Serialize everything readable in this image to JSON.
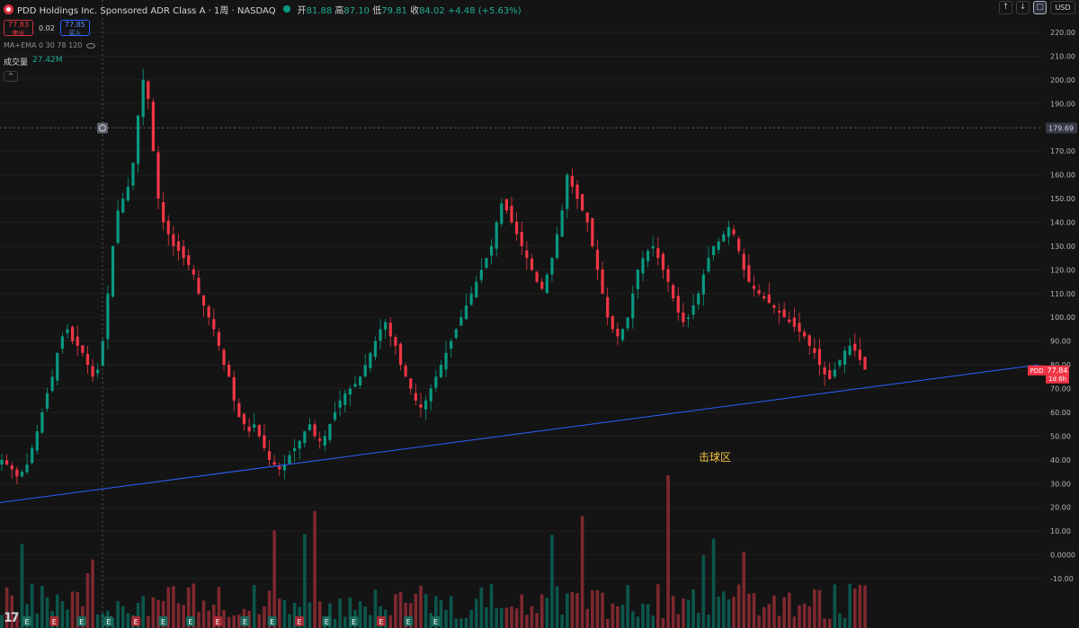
{
  "header": {
    "symbol_title": "PDD Holdings Inc. Sponsored ADR Class A · 1周 · NASDAQ",
    "open_label": "开",
    "open_value": "81.88",
    "high_label": "高",
    "high_value": "87.10",
    "low_label": "低",
    "low_value": "79.81",
    "close_label": "收",
    "close_value": "84.02",
    "change": "+4.48 (+5.63%)",
    "sell_price": "77.83",
    "sell_label": "卖出",
    "spread": "0.02",
    "buy_price": "77.85",
    "buy_label": "买入",
    "indicator": "MA+EMA 0 30 78 120",
    "volume_label": "成交量",
    "volume_value": "27.42M",
    "collapse_glyph": "^"
  },
  "toolbar": {
    "up_glyph": "↑",
    "down_glyph": "↓",
    "box_glyph": "□",
    "currency": "USD"
  },
  "annotation_text": "击球区",
  "crosshair_label": "179.69",
  "last_price": {
    "symbol": "PDD",
    "price": "77.84",
    "countdown": "1d 6h"
  },
  "earnings_marker": "E",
  "tv_logo": "17",
  "colors": {
    "up": "#089981",
    "down": "#f23645",
    "trend": "#2962ff",
    "annotation": "#f5c542"
  },
  "chart_data": {
    "type": "candlestick",
    "y_ticks": [
      "220.00",
      "210.00",
      "200.00",
      "190.00",
      "180.00",
      "170.00",
      "160.00",
      "150.00",
      "140.00",
      "130.00",
      "120.00",
      "110.00",
      "100.00",
      "90.00",
      "80.00",
      "70.00",
      "60.00",
      "50.00",
      "40.00",
      "30.00",
      "20.00",
      "10.00",
      "0.0000",
      "-10.00"
    ],
    "ylim": [
      -10,
      220
    ],
    "close_path": [
      40,
      38,
      36,
      33,
      35,
      38,
      45,
      52,
      60,
      68,
      75,
      85,
      92,
      95,
      90,
      88,
      85,
      80,
      75,
      78,
      90,
      110,
      130,
      145,
      150,
      155,
      165,
      185,
      200,
      192,
      170,
      150,
      140,
      135,
      130,
      128,
      125,
      122,
      118,
      110,
      105,
      100,
      95,
      88,
      80,
      75,
      65,
      58,
      55,
      52,
      55,
      50,
      45,
      40,
      38,
      36,
      38,
      42,
      45,
      48,
      52,
      55,
      50,
      48,
      50,
      55,
      60,
      65,
      68,
      70,
      72,
      75,
      80,
      85,
      90,
      95,
      98,
      92,
      88,
      80,
      75,
      70,
      65,
      62,
      65,
      70,
      75,
      80,
      85,
      90,
      95,
      100,
      105,
      110,
      115,
      120,
      125,
      130,
      140,
      148,
      145,
      140,
      135,
      130,
      125,
      120,
      115,
      112,
      118,
      125,
      135,
      145,
      160,
      155,
      150,
      145,
      140,
      130,
      120,
      110,
      100,
      95,
      92,
      95,
      100,
      110,
      120,
      125,
      128,
      130,
      125,
      120,
      115,
      108,
      102,
      98,
      100,
      105,
      110,
      118,
      125,
      130,
      132,
      135,
      138,
      135,
      128,
      120,
      115,
      112,
      110,
      108,
      106,
      104,
      102,
      100,
      98,
      96,
      94,
      92,
      88,
      85,
      80,
      76,
      74,
      78,
      82,
      86,
      88,
      86,
      82,
      78
    ],
    "trendline": {
      "from": [
        0,
        22
      ],
      "to": [
        1155,
        80
      ]
    },
    "crosshair_price": 179.69,
    "last_price": 77.84
  }
}
